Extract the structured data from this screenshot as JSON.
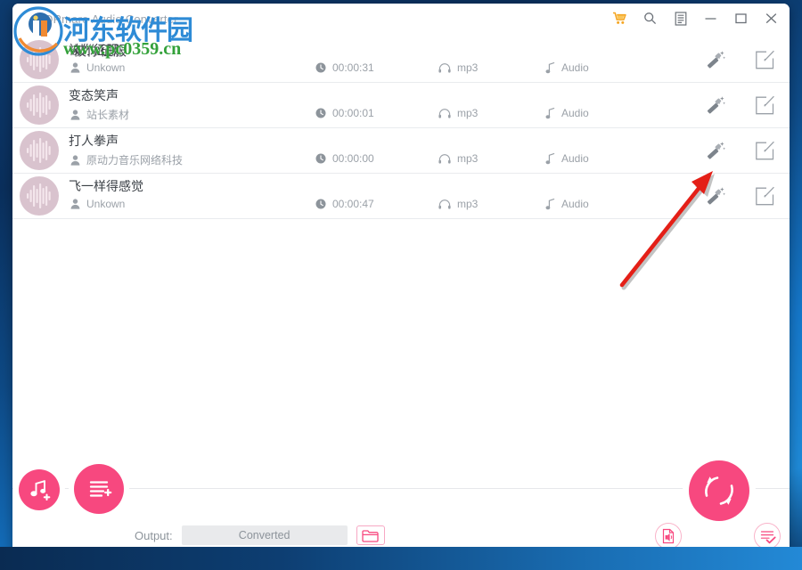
{
  "window": {
    "app_title": "DRmare Audio Converter",
    "accent_color": "#f7487f",
    "controls": [
      {
        "name": "cart-icon",
        "label": "Buy",
        "glyph": "cart"
      },
      {
        "name": "search-icon",
        "label": "Search",
        "glyph": "search"
      },
      {
        "name": "menu-icon",
        "label": "Menu",
        "glyph": "menu"
      },
      {
        "name": "minimize-icon",
        "label": "Minimize",
        "glyph": "minimize"
      },
      {
        "name": "maximize-icon",
        "label": "Maximize",
        "glyph": "maximize"
      },
      {
        "name": "close-icon",
        "label": "Close",
        "glyph": "close"
      }
    ]
  },
  "watermark": {
    "site_cn": "河东软件园",
    "site_url": "www.pc0359.cn"
  },
  "file_list": {
    "rows": [
      {
        "title": "被你征服",
        "artist": "Unkown",
        "duration": "00:00:31",
        "format": "mp3",
        "type": "Audio",
        "effects_label": "Effects",
        "edit_label": "Edit"
      },
      {
        "title": "变态笑声",
        "artist": "站长素材",
        "duration": "00:00:01",
        "format": "mp3",
        "type": "Audio",
        "effects_label": "Effects",
        "edit_label": "Edit"
      },
      {
        "title": "打人拳声",
        "artist": "原动力音乐网络科技",
        "duration": "00:00:00",
        "format": "mp3",
        "type": "Audio",
        "effects_label": "Effects",
        "edit_label": "Edit"
      },
      {
        "title": "飞一样得感觉",
        "artist": "Unkown",
        "duration": "00:00:47",
        "format": "mp3",
        "type": "Audio",
        "effects_label": "Effects",
        "edit_label": "Edit"
      }
    ]
  },
  "bottom_bar": {
    "add_file_label": "Add File",
    "add_folder_label": "Add Folder",
    "output_label": "Output:",
    "output_value": "Converted",
    "browse_label": "Browse",
    "convert_label": "Convert",
    "file_info_label": "File Info",
    "task_list_label": "Task List"
  }
}
